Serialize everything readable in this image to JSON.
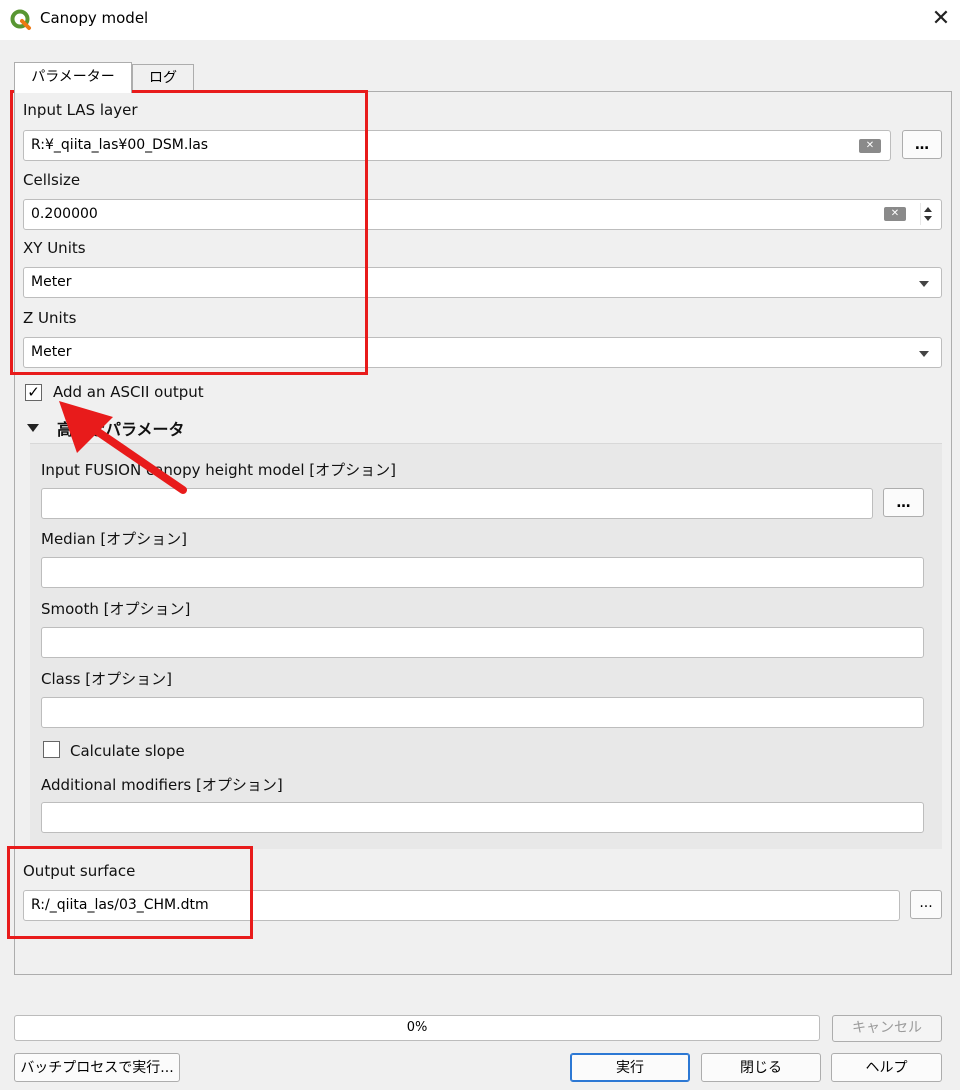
{
  "window": {
    "title": "Canopy model",
    "close_glyph": "✕",
    "app_icon": "qgis-logo-icon"
  },
  "tabs": [
    {
      "label": "パラメーター"
    },
    {
      "label": "ログ"
    }
  ],
  "params": {
    "input_las": {
      "label": "Input LAS layer",
      "value": "R:¥_qiita_las¥00_DSM.las",
      "browse": "…"
    },
    "cellsize": {
      "label": "Cellsize",
      "value": "0.200000",
      "spin_icon": "spinbox-arrows-icon"
    },
    "xy_units": {
      "label": "XY Units",
      "value": "Meter"
    },
    "z_units": {
      "label": "Z Units",
      "value": "Meter"
    },
    "ascii": {
      "label": "Add an ASCII output",
      "checked": true,
      "mark": "✓"
    }
  },
  "advanced": {
    "toggle_label": "高度なパラメータ",
    "chm": {
      "label": "Input FUSION canopy height model [オプション]",
      "value": "",
      "browse": "…"
    },
    "median": {
      "label": "Median [オプション]",
      "value": ""
    },
    "smooth": {
      "label": "Smooth [オプション]",
      "value": ""
    },
    "class": {
      "label": "Class [オプション]",
      "value": ""
    },
    "slope": {
      "label": "Calculate slope",
      "checked": false
    },
    "modifiers": {
      "label": "Additional modifiers [オプション]",
      "value": ""
    }
  },
  "output": {
    "label": "Output surface",
    "value": "R:/_qiita_las/03_CHM.dtm",
    "browse": "..."
  },
  "progress": {
    "value": 0,
    "text": "0%"
  },
  "buttons": {
    "cancel": "キャンセル",
    "batch": "バッチプロセスで実行...",
    "run": "実行",
    "close": "閉じる",
    "help": "ヘルプ"
  },
  "annotation_colors": {
    "red": "#e81b1b"
  }
}
